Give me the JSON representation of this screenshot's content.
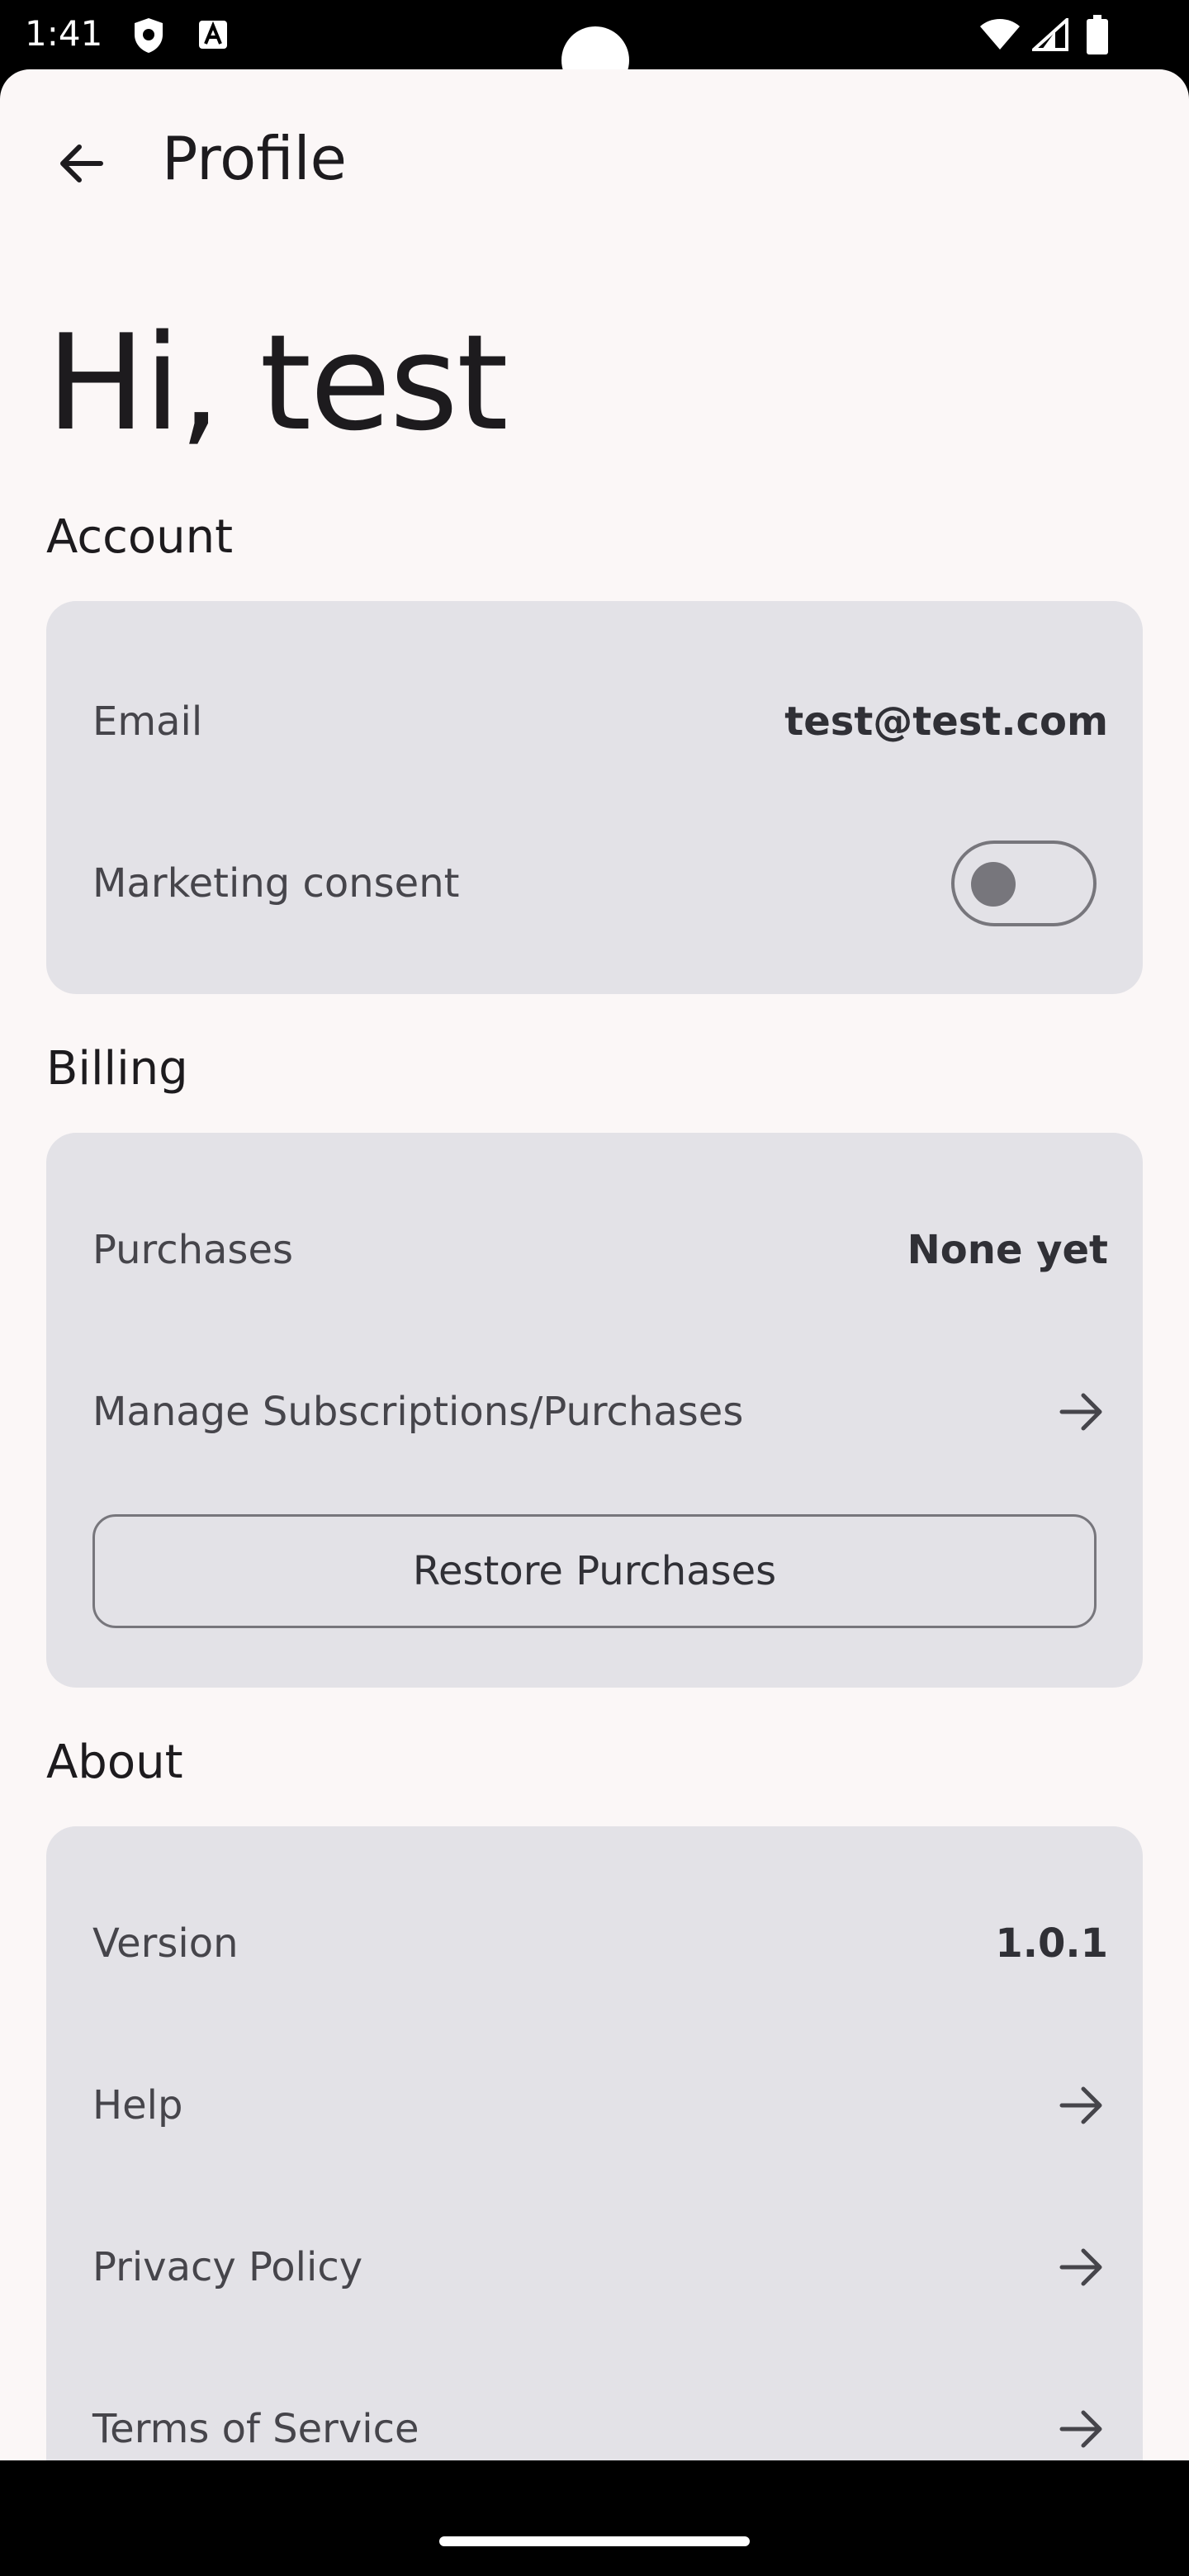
{
  "status_bar": {
    "time": "1:41",
    "icons": [
      "shield-icon",
      "a-notification-icon",
      "wifi-icon",
      "signal-icon",
      "battery-icon"
    ]
  },
  "app_bar": {
    "back_icon": "arrow-back-icon",
    "title": "Profile"
  },
  "greeting": "Hi, test",
  "account": {
    "title": "Account",
    "email_label": "Email",
    "email_value": "test@test.com",
    "marketing_label": "Marketing consent",
    "marketing_enabled": false
  },
  "billing": {
    "title": "Billing",
    "purchases_label": "Purchases",
    "purchases_value": "None yet",
    "manage_label": "Manage Subscriptions/Purchases",
    "restore_label": "Restore Purchases"
  },
  "about": {
    "title": "About",
    "version_label": "Version",
    "version_value": "1.0.1",
    "help_label": "Help",
    "privacy_label": "Privacy Policy",
    "terms_label": "Terms of Service"
  },
  "colors": {
    "background": "#fbf7f7",
    "card": "#e3e2e7",
    "text_primary": "#1d1b1e",
    "text_secondary": "#46454b",
    "outline": "#77767c"
  }
}
